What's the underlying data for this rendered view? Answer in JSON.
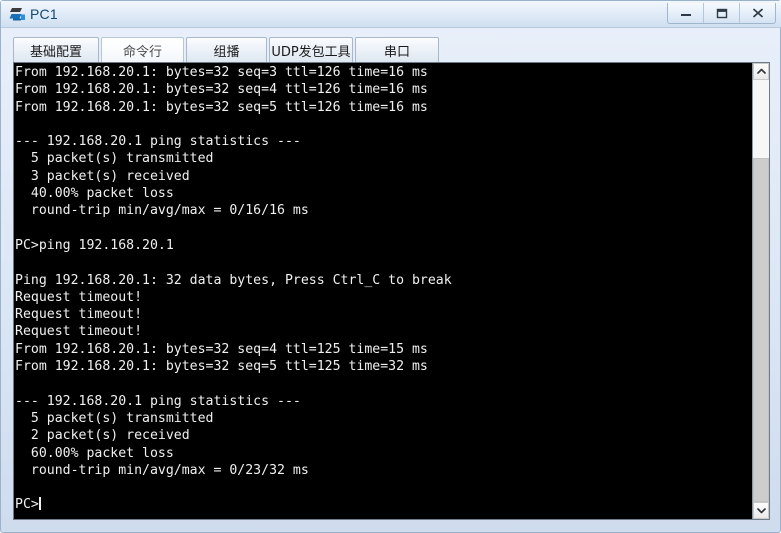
{
  "window": {
    "title": "PC1",
    "icon": "pc-device-icon",
    "controls": [
      {
        "name": "minimize-button",
        "glyph": "minimize-icon",
        "label": "—"
      },
      {
        "name": "maximize-button",
        "glyph": "maximize-icon",
        "label": "□"
      },
      {
        "name": "close-button",
        "glyph": "close-icon",
        "label": "X"
      }
    ]
  },
  "tabs": [
    {
      "label": "基础配置",
      "selected": false
    },
    {
      "label": "命令行",
      "selected": true
    },
    {
      "label": "组播",
      "selected": false
    },
    {
      "label": "UDP发包工具",
      "selected": false
    },
    {
      "label": "串口",
      "selected": false
    }
  ],
  "terminal": {
    "prompt": "PC>",
    "cursor_visible": true,
    "foreground_color": "#f0f0f0",
    "background_color": "#000000",
    "lines": [
      "From 192.168.20.1: bytes=32 seq=3 ttl=126 time=16 ms",
      "From 192.168.20.1: bytes=32 seq=4 ttl=126 time=16 ms",
      "From 192.168.20.1: bytes=32 seq=5 ttl=126 time=16 ms",
      "",
      "--- 192.168.20.1 ping statistics ---",
      "  5 packet(s) transmitted",
      "  3 packet(s) received",
      "  40.00% packet loss",
      "  round-trip min/avg/max = 0/16/16 ms",
      "",
      "PC>ping 192.168.20.1",
      "",
      "Ping 192.168.20.1: 32 data bytes, Press Ctrl_C to break",
      "Request timeout!",
      "Request timeout!",
      "Request timeout!",
      "From 192.168.20.1: bytes=32 seq=4 ttl=125 time=15 ms",
      "From 192.168.20.1: bytes=32 seq=5 ttl=125 time=32 ms",
      "",
      "--- 192.168.20.1 ping statistics ---",
      "  5 packet(s) transmitted",
      "  2 packet(s) received",
      "  60.00% packet loss",
      "  round-trip min/avg/max = 0/23/32 ms",
      "",
      "PC>"
    ]
  },
  "scrollbar": {
    "up_arrow": "chevron-up-icon",
    "down_arrow": "chevron-down-icon"
  }
}
